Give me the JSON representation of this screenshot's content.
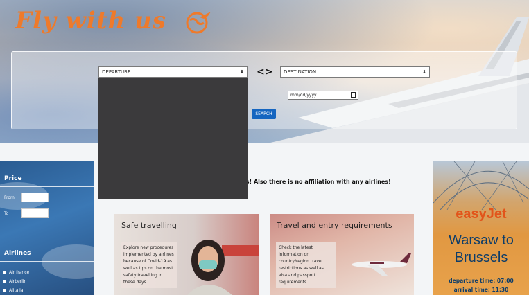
{
  "header": {
    "logo_text": "Fly with us"
  },
  "search": {
    "departure": "DEPARTURE",
    "destination": "DESTINATION",
    "swap_symbol": "<>",
    "date_placeholder": "mm/dd/yyyy",
    "search_label": "SEARCH"
  },
  "notice": {
    "text": "g site. We offer no real services! Also there is no affiliation with any airlines!"
  },
  "sidebar": {
    "price_title": "Price",
    "from_label": "From",
    "to_label": "To",
    "airlines_title": "Airlines",
    "airlines": [
      "Air france",
      "Airberlin",
      "Alitalia"
    ]
  },
  "cards": [
    {
      "title": "Safe travelling",
      "desc": "Explore new procedures implemented by airlines because of Covid-19 as well as tips on the most safety travelling in these days."
    },
    {
      "title": "Travel and entry requirements",
      "desc": "Check the latest information on country/region travel restrictions as well as visa and passport requirements"
    }
  ],
  "ad": {
    "brand": "easyJet",
    "route_line1": "Warsaw to",
    "route_line2": "Brussels",
    "departure": "departure time: 07:00",
    "arrival": "arrival time: 11:30"
  },
  "colors": {
    "accent_orange": "#ee7a2b",
    "button_blue": "#1565c0",
    "ad_navy": "#0e3d69"
  }
}
